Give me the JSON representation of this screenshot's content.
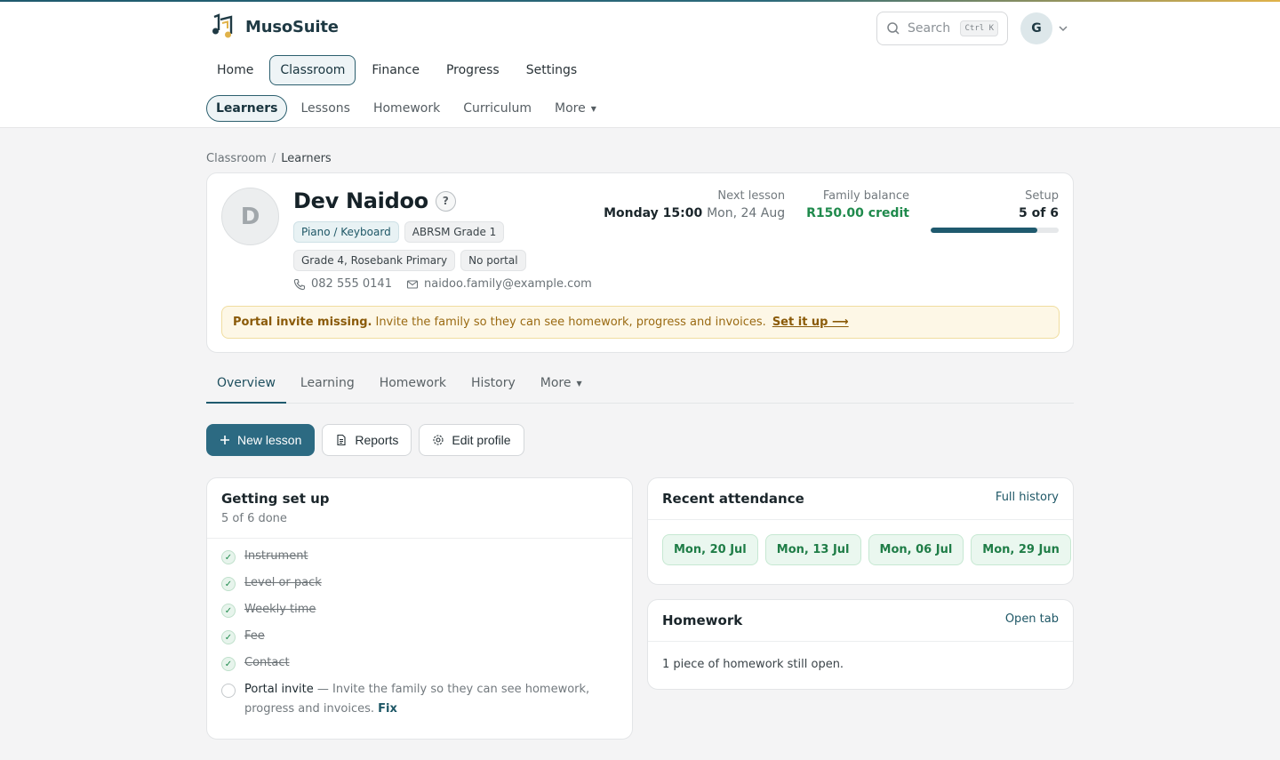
{
  "app": {
    "name": "MusoSuite",
    "search_placeholder": "Search",
    "search_shortcut": "Ctrl K",
    "user_initial": "G"
  },
  "main_nav": [
    {
      "label": "Home",
      "active": false
    },
    {
      "label": "Classroom",
      "active": true
    },
    {
      "label": "Finance",
      "active": false
    },
    {
      "label": "Progress",
      "active": false
    },
    {
      "label": "Settings",
      "active": false
    }
  ],
  "sub_nav": [
    {
      "label": "Learners",
      "active": true
    },
    {
      "label": "Lessons",
      "active": false
    },
    {
      "label": "Homework",
      "active": false
    },
    {
      "label": "Curriculum",
      "active": false
    },
    {
      "label": "More",
      "active": false
    }
  ],
  "breadcrumb": {
    "root": "Classroom",
    "separator": "/",
    "current": "Learners"
  },
  "learner": {
    "initial": "D",
    "name": "Dev Naidoo",
    "help": "?",
    "tags": [
      "Piano / Keyboard",
      "ABRSM Grade 1",
      "Grade 4, Rosebank Primary",
      "No portal"
    ],
    "phone": "082 555 0141",
    "email": "naidoo.family@example.com"
  },
  "stats": {
    "next_lesson_label": "Next lesson",
    "next_lesson_main": "Monday 15:00",
    "next_lesson_date": "Mon, 24 Aug",
    "balance_label": "Family balance",
    "balance_value": "R150.00 credit",
    "setup_label": "Setup",
    "setup_value": "5 of 6",
    "setup_progress": 0.833
  },
  "alert": {
    "title": "Portal invite missing.",
    "text": "Invite the family so they can see homework, progress and invoices.",
    "link": "Set it up ⟶"
  },
  "tabs": [
    "Overview",
    "Learning",
    "Homework",
    "History",
    "More"
  ],
  "actions": {
    "new_lesson": "New lesson",
    "reports": "Reports",
    "edit_profile": "Edit profile"
  },
  "getting_set_up": {
    "title": "Getting set up",
    "subtitle": "5 of 6 done",
    "done_items": [
      "Instrument",
      "Level or pack",
      "Weekly time",
      "Fee",
      "Contact"
    ],
    "open_item": {
      "label": "Portal invite",
      "dash": " — ",
      "desc": "Invite the family so they can see homework, progress and invoices.",
      "fix": "Fix"
    }
  },
  "attendance": {
    "title": "Recent attendance",
    "link": "Full history",
    "dates": [
      "Mon, 20 Jul",
      "Mon, 13 Jul",
      "Mon, 06 Jul",
      "Mon, 29 Jun",
      ""
    ]
  },
  "homework": {
    "title": "Homework",
    "link": "Open tab",
    "body": "1 piece of homework still open."
  }
}
